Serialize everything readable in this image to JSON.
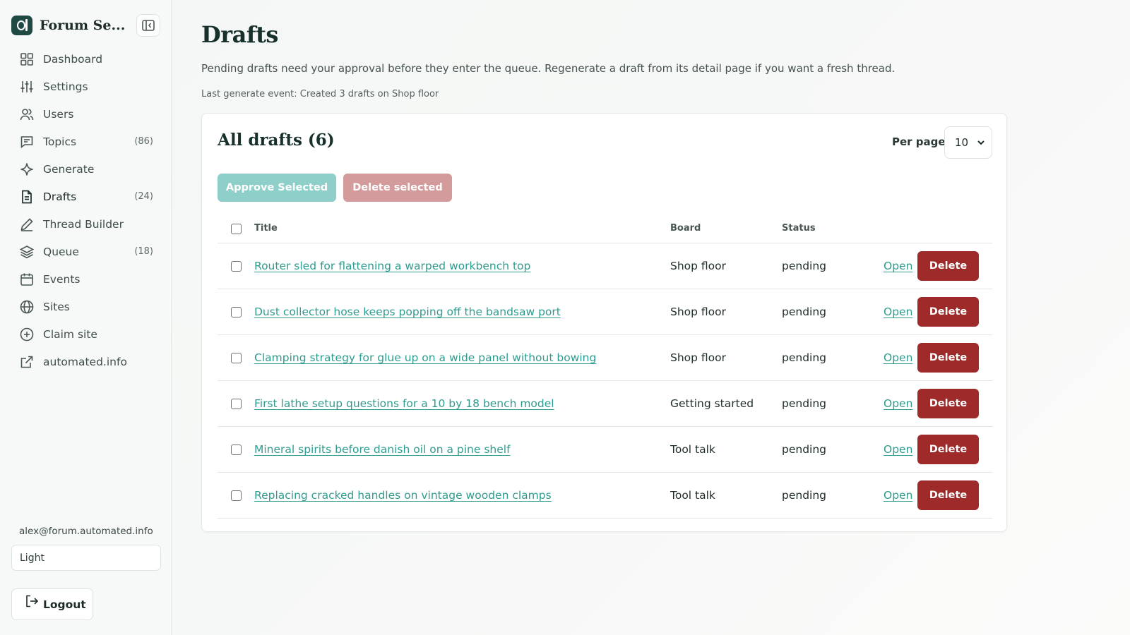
{
  "app": {
    "name": "Forum Se..."
  },
  "sidebar": {
    "items": [
      {
        "label": "Dashboard",
        "icon": "dashboard-icon",
        "count": ""
      },
      {
        "label": "Settings",
        "icon": "sliders-icon",
        "count": ""
      },
      {
        "label": "Users",
        "icon": "users-icon",
        "count": ""
      },
      {
        "label": "Topics",
        "icon": "message-icon",
        "count": "(86)"
      },
      {
        "label": "Generate",
        "icon": "sparkle-icon",
        "count": ""
      },
      {
        "label": "Drafts",
        "icon": "document-icon",
        "count": "(24)",
        "active": true
      },
      {
        "label": "Thread Builder",
        "icon": "pencil-icon",
        "count": ""
      },
      {
        "label": "Queue",
        "icon": "layers-icon",
        "count": "(18)"
      },
      {
        "label": "Events",
        "icon": "calendar-icon",
        "count": ""
      },
      {
        "label": "Sites",
        "icon": "globe-icon",
        "count": ""
      },
      {
        "label": "Claim site",
        "icon": "plus-circle-icon",
        "count": ""
      },
      {
        "label": "automated.info",
        "icon": "external-link-icon",
        "count": ""
      }
    ],
    "user_email": "alex@forum.automated.info",
    "theme_value": "Light",
    "logout_label": "Logout"
  },
  "main": {
    "title": "Drafts",
    "description": "Pending drafts need your approval before they enter the queue. Regenerate a draft from its detail page if you want a fresh thread.",
    "last_event": "Last generate event: Created 3 drafts on Shop floor",
    "card": {
      "title": "All drafts (6)",
      "per_page_label": "Per page",
      "per_page_value": "10",
      "approve_label": "Approve Selected",
      "delete_selected_label": "Delete selected",
      "columns": {
        "title": "Title",
        "board": "Board",
        "status": "Status"
      },
      "rows": [
        {
          "title": "Router sled for flattening a warped workbench top",
          "board": "Shop floor",
          "status": "pending",
          "open": "Open",
          "delete": "Delete"
        },
        {
          "title": "Dust collector hose keeps popping off the bandsaw port",
          "board": "Shop floor",
          "status": "pending",
          "open": "Open",
          "delete": "Delete"
        },
        {
          "title": "Clamping strategy for glue up on a wide panel without bowing",
          "board": "Shop floor",
          "status": "pending",
          "open": "Open",
          "delete": "Delete"
        },
        {
          "title": "First lathe setup questions for a 10 by 18 bench model",
          "board": "Getting started",
          "status": "pending",
          "open": "Open",
          "delete": "Delete"
        },
        {
          "title": "Mineral spirits before danish oil on a pine shelf",
          "board": "Tool talk",
          "status": "pending",
          "open": "Open",
          "delete": "Delete"
        },
        {
          "title": "Replacing cracked handles on vintage wooden clamps",
          "board": "Tool talk",
          "status": "pending",
          "open": "Open",
          "delete": "Delete"
        }
      ]
    }
  },
  "colors": {
    "accent": "#2e9c8e",
    "brand": "#1f4a43",
    "danger": "#9e2a2a",
    "approve_disabled": "#8fcfca",
    "delete_disabled": "#d39b9b"
  }
}
